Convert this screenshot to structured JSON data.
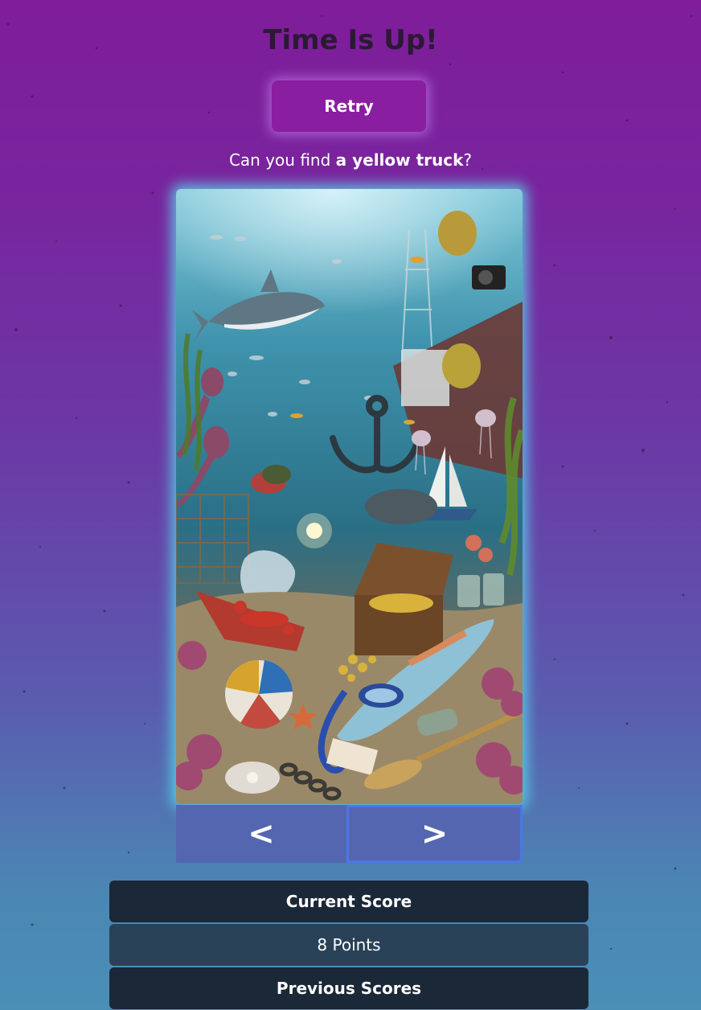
{
  "header": {
    "title": "Time Is Up!"
  },
  "actions": {
    "retry_label": "Retry"
  },
  "prompt": {
    "lead": "Can you find ",
    "target": "a yellow truck",
    "tail": "?"
  },
  "scene": {
    "description_icon": "underwater-scene-image"
  },
  "navigation": {
    "prev_label": "<",
    "next_label": ">"
  },
  "scores": {
    "current_label": "Current Score",
    "current_value": "8 Points",
    "previous_label": "Previous Scores"
  },
  "colors": {
    "background_top": "#7f1d9a",
    "background_bottom": "#4a8fb6",
    "retry": "#8a1ea0",
    "nav": "#5566b0",
    "score_dark": "#1b2838",
    "score_mid": "#2a4258"
  }
}
